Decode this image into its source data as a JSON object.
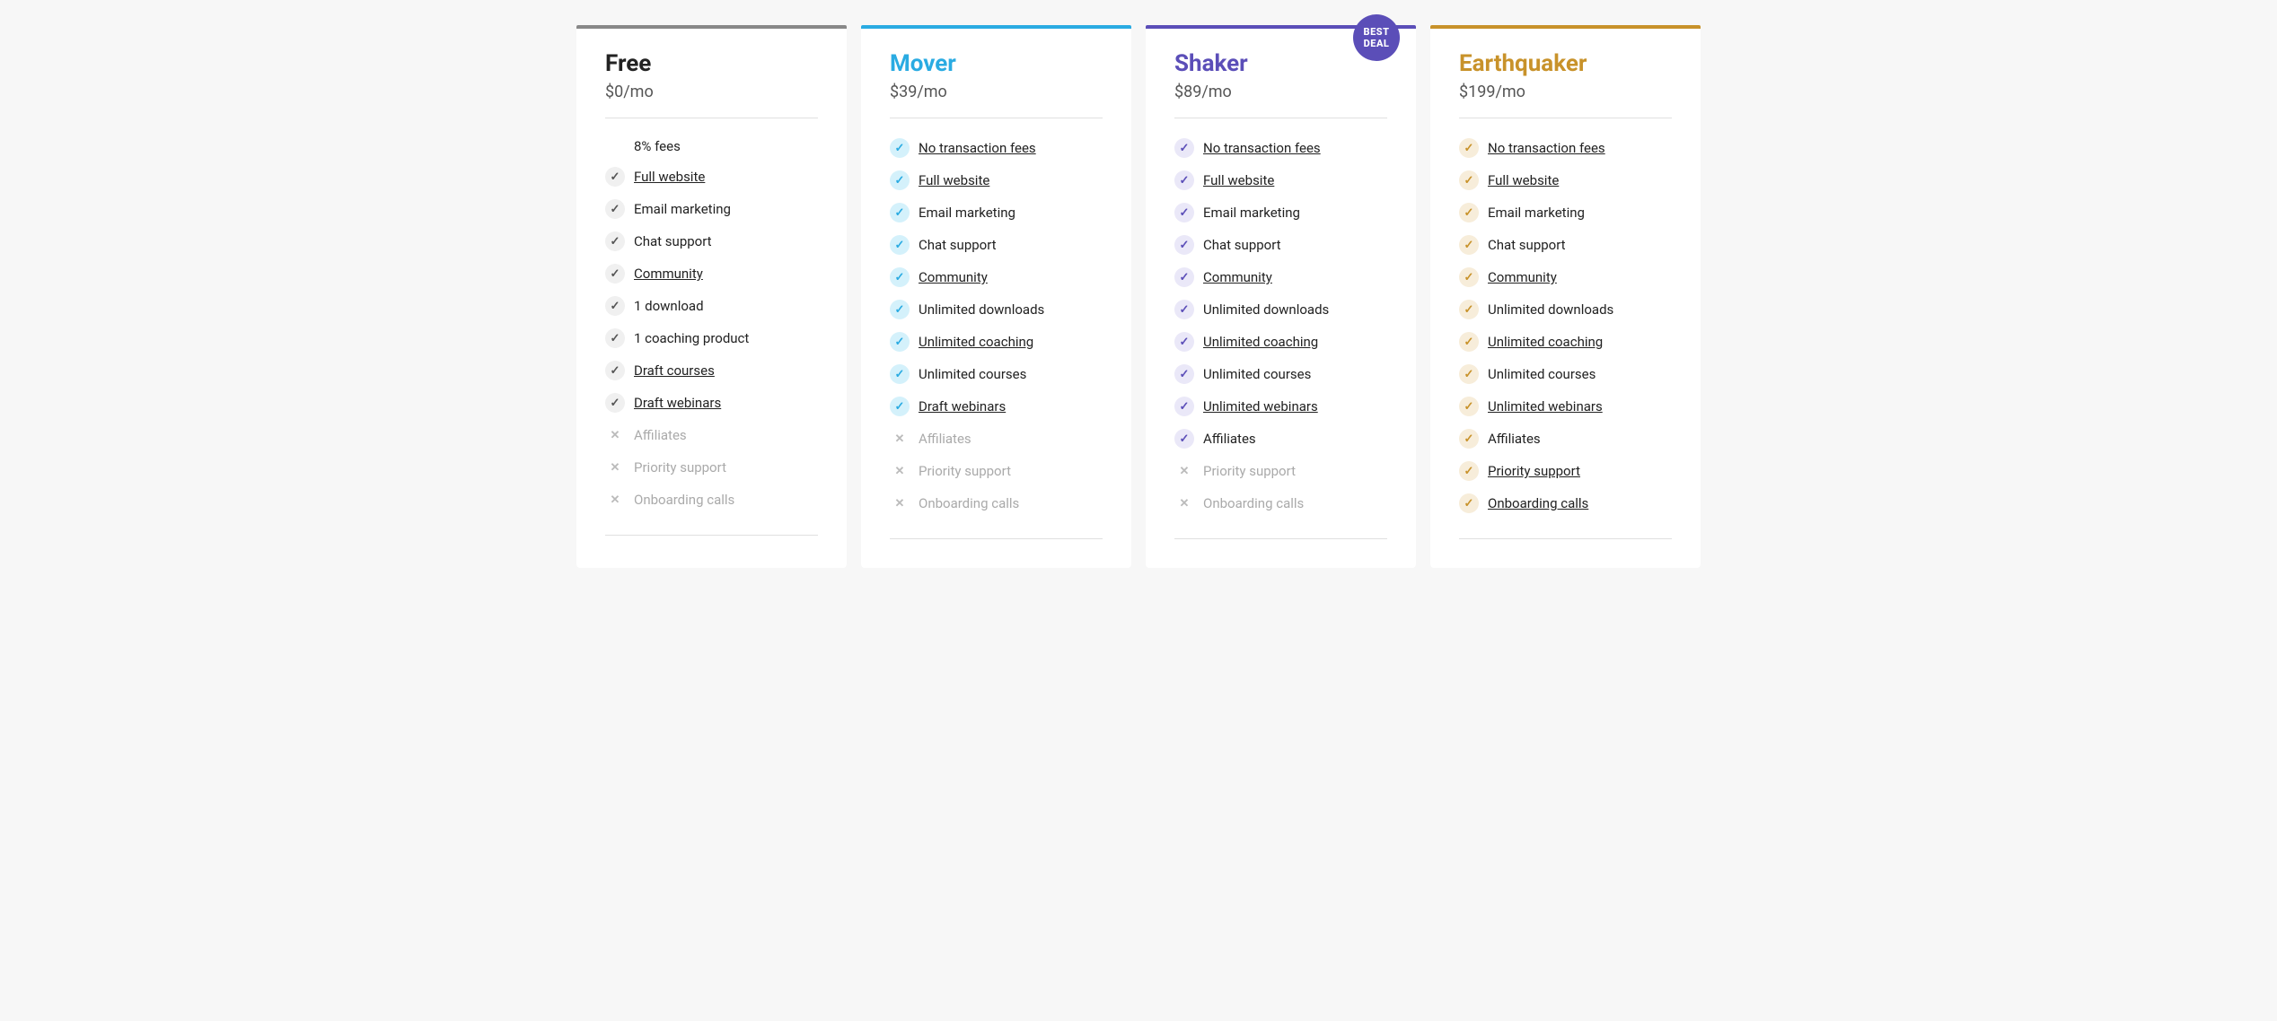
{
  "plans": [
    {
      "id": "free",
      "name": "Free",
      "price": "$0/mo",
      "colorClass": "free",
      "bestDeal": false,
      "features": [
        {
          "label": "8% fees",
          "included": true,
          "underlined": false,
          "iconType": "none"
        },
        {
          "label": "Full website",
          "included": true,
          "underlined": true,
          "iconType": "check"
        },
        {
          "label": "Email marketing",
          "included": true,
          "underlined": false,
          "iconType": "check"
        },
        {
          "label": "Chat support",
          "included": true,
          "underlined": false,
          "iconType": "check"
        },
        {
          "label": "Community",
          "included": true,
          "underlined": true,
          "iconType": "check"
        },
        {
          "label": "1 download",
          "included": true,
          "underlined": false,
          "iconType": "check"
        },
        {
          "label": "1 coaching product",
          "included": true,
          "underlined": false,
          "iconType": "check"
        },
        {
          "label": "Draft courses",
          "included": true,
          "underlined": true,
          "iconType": "check"
        },
        {
          "label": "Draft webinars",
          "included": true,
          "underlined": true,
          "iconType": "check"
        },
        {
          "label": "Affiliates",
          "included": false,
          "underlined": false,
          "iconType": "cross"
        },
        {
          "label": "Priority support",
          "included": false,
          "underlined": false,
          "iconType": "cross"
        },
        {
          "label": "Onboarding calls",
          "included": false,
          "underlined": false,
          "iconType": "cross"
        }
      ]
    },
    {
      "id": "mover",
      "name": "Mover",
      "price": "$39/mo",
      "colorClass": "mover",
      "bestDeal": false,
      "features": [
        {
          "label": "No transaction fees",
          "included": true,
          "underlined": true,
          "iconType": "check"
        },
        {
          "label": "Full website",
          "included": true,
          "underlined": true,
          "iconType": "check"
        },
        {
          "label": "Email marketing",
          "included": true,
          "underlined": false,
          "iconType": "check"
        },
        {
          "label": "Chat support",
          "included": true,
          "underlined": false,
          "iconType": "check"
        },
        {
          "label": "Community",
          "included": true,
          "underlined": true,
          "iconType": "check"
        },
        {
          "label": "Unlimited downloads",
          "included": true,
          "underlined": false,
          "iconType": "check"
        },
        {
          "label": "Unlimited coaching",
          "included": true,
          "underlined": true,
          "iconType": "check"
        },
        {
          "label": "Unlimited courses",
          "included": true,
          "underlined": false,
          "iconType": "check"
        },
        {
          "label": "Draft webinars",
          "included": true,
          "underlined": true,
          "iconType": "check"
        },
        {
          "label": "Affiliates",
          "included": false,
          "underlined": false,
          "iconType": "cross"
        },
        {
          "label": "Priority support",
          "included": false,
          "underlined": false,
          "iconType": "cross"
        },
        {
          "label": "Onboarding calls",
          "included": false,
          "underlined": false,
          "iconType": "cross"
        }
      ]
    },
    {
      "id": "shaker",
      "name": "Shaker",
      "price": "$89/mo",
      "colorClass": "shaker",
      "bestDeal": true,
      "bestDealText": "BEST\nDEAL",
      "features": [
        {
          "label": "No transaction fees",
          "included": true,
          "underlined": true,
          "iconType": "check"
        },
        {
          "label": "Full website",
          "included": true,
          "underlined": true,
          "iconType": "check"
        },
        {
          "label": "Email marketing",
          "included": true,
          "underlined": false,
          "iconType": "check"
        },
        {
          "label": "Chat support",
          "included": true,
          "underlined": false,
          "iconType": "check"
        },
        {
          "label": "Community",
          "included": true,
          "underlined": true,
          "iconType": "check"
        },
        {
          "label": "Unlimited downloads",
          "included": true,
          "underlined": false,
          "iconType": "check"
        },
        {
          "label": "Unlimited coaching",
          "included": true,
          "underlined": true,
          "iconType": "check"
        },
        {
          "label": "Unlimited courses",
          "included": true,
          "underlined": false,
          "iconType": "check"
        },
        {
          "label": "Unlimited webinars",
          "included": true,
          "underlined": true,
          "iconType": "check"
        },
        {
          "label": "Affiliates",
          "included": true,
          "underlined": false,
          "iconType": "check"
        },
        {
          "label": "Priority support",
          "included": false,
          "underlined": false,
          "iconType": "cross"
        },
        {
          "label": "Onboarding calls",
          "included": false,
          "underlined": false,
          "iconType": "cross"
        }
      ]
    },
    {
      "id": "earthquaker",
      "name": "Earthquaker",
      "price": "$199/mo",
      "colorClass": "earthquaker",
      "bestDeal": false,
      "features": [
        {
          "label": "No transaction fees",
          "included": true,
          "underlined": true,
          "iconType": "check"
        },
        {
          "label": "Full website",
          "included": true,
          "underlined": true,
          "iconType": "check"
        },
        {
          "label": "Email marketing",
          "included": true,
          "underlined": false,
          "iconType": "check"
        },
        {
          "label": "Chat support",
          "included": true,
          "underlined": false,
          "iconType": "check"
        },
        {
          "label": "Community",
          "included": true,
          "underlined": true,
          "iconType": "check"
        },
        {
          "label": "Unlimited downloads",
          "included": true,
          "underlined": false,
          "iconType": "check"
        },
        {
          "label": "Unlimited coaching",
          "included": true,
          "underlined": true,
          "iconType": "check"
        },
        {
          "label": "Unlimited courses",
          "included": true,
          "underlined": false,
          "iconType": "check"
        },
        {
          "label": "Unlimited webinars",
          "included": true,
          "underlined": true,
          "iconType": "check"
        },
        {
          "label": "Affiliates",
          "included": true,
          "underlined": false,
          "iconType": "check"
        },
        {
          "label": "Priority support",
          "included": true,
          "underlined": true,
          "iconType": "check"
        },
        {
          "label": "Onboarding calls",
          "included": true,
          "underlined": true,
          "iconType": "check"
        }
      ]
    }
  ]
}
